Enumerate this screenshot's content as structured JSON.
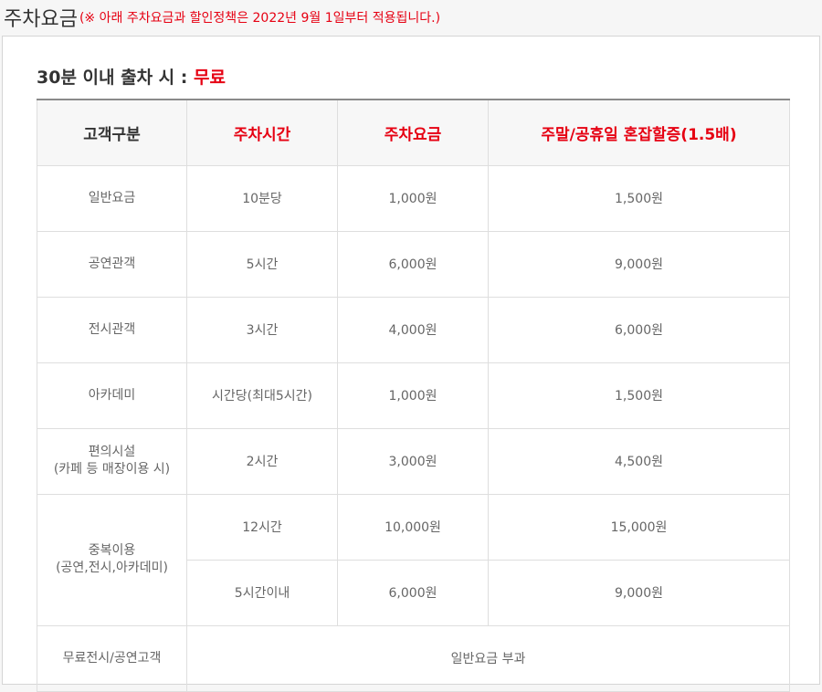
{
  "heading": {
    "title": "주차요금",
    "note": "(※ 아래 주차요금과 할인정책은 2022년 9월 1일부터 적용됩니다.)"
  },
  "subheading": {
    "prefix": "30분 이내 출차 시 : ",
    "accent": "무료"
  },
  "table": {
    "headers": [
      "고객구분",
      "주차시간",
      "주차요금",
      "주말/공휴일 혼잡할증(1.5배)"
    ],
    "rows": [
      {
        "category": "일반요금",
        "time": "10분당",
        "fee": "1,000원",
        "surcharge": "1,500원"
      },
      {
        "category": "공연관객",
        "time": "5시간",
        "fee": "6,000원",
        "surcharge": "9,000원"
      },
      {
        "category": "전시관객",
        "time": "3시간",
        "fee": "4,000원",
        "surcharge": "6,000원"
      },
      {
        "category": "아카데미",
        "time": "시간당(최대5시간)",
        "fee": "1,000원",
        "surcharge": "1,500원"
      },
      {
        "category_line1": "편의시설",
        "category_line2": "(카페 등 매장이용 시)",
        "time": "2시간",
        "fee": "3,000원",
        "surcharge": "4,500원"
      }
    ],
    "overlap": {
      "category_line1": "중복이용",
      "category_line2": "(공연,전시,아카데미)",
      "rows": [
        {
          "time": "12시간",
          "fee": "10,000원",
          "surcharge": "15,000원"
        },
        {
          "time": "5시간이내",
          "fee": "6,000원",
          "surcharge": "9,000원"
        }
      ]
    },
    "free_row": {
      "category": "무료전시/공연고객",
      "value": "일반요금 부과"
    }
  },
  "colors": {
    "accent": "#e60012",
    "header_bg": "#f7f7f7",
    "border": "#dedede",
    "page_bg": "#f6f6f6"
  }
}
